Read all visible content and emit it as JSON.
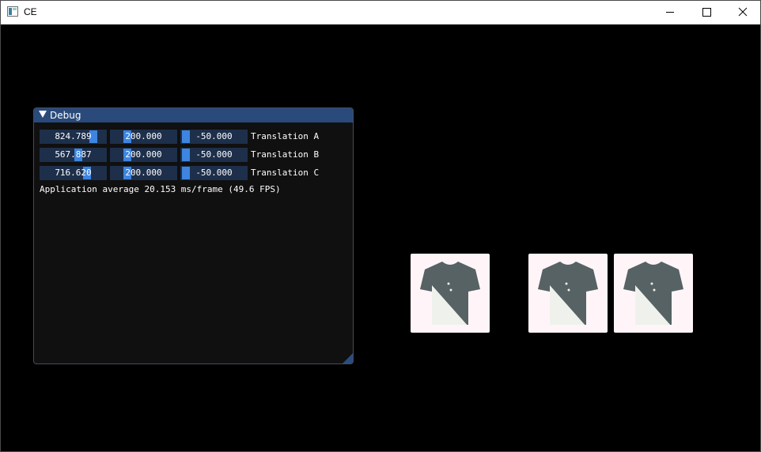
{
  "window": {
    "title": "CE",
    "controls": {
      "minimize": "minimize",
      "maximize": "maximize",
      "close": "close"
    }
  },
  "debug": {
    "title": "Debug",
    "rows": [
      {
        "x": "824.789",
        "y": "200.000",
        "z": "-50.000",
        "label": "Translation A"
      },
      {
        "x": "567.887",
        "y": "200.000",
        "z": "-50.000",
        "label": "Translation B"
      },
      {
        "x": "716.620",
        "y": "200.000",
        "z": "-50.000",
        "label": "Translation C"
      }
    ],
    "stats": "Application average 20.153 ms/frame (49.6 FPS)"
  },
  "tiles": [
    {
      "image": "tshirt-icon"
    },
    {
      "image": "tshirt-icon"
    },
    {
      "image": "tshirt-icon"
    }
  ],
  "colors": {
    "panel_header": "#294a7a",
    "field_bg": "#1d2f4a",
    "slider_grab": "#3d85e0",
    "tile_bg": "#fff5f8",
    "shirt_dark": "#566264",
    "shirt_light": "#eff1ec"
  }
}
